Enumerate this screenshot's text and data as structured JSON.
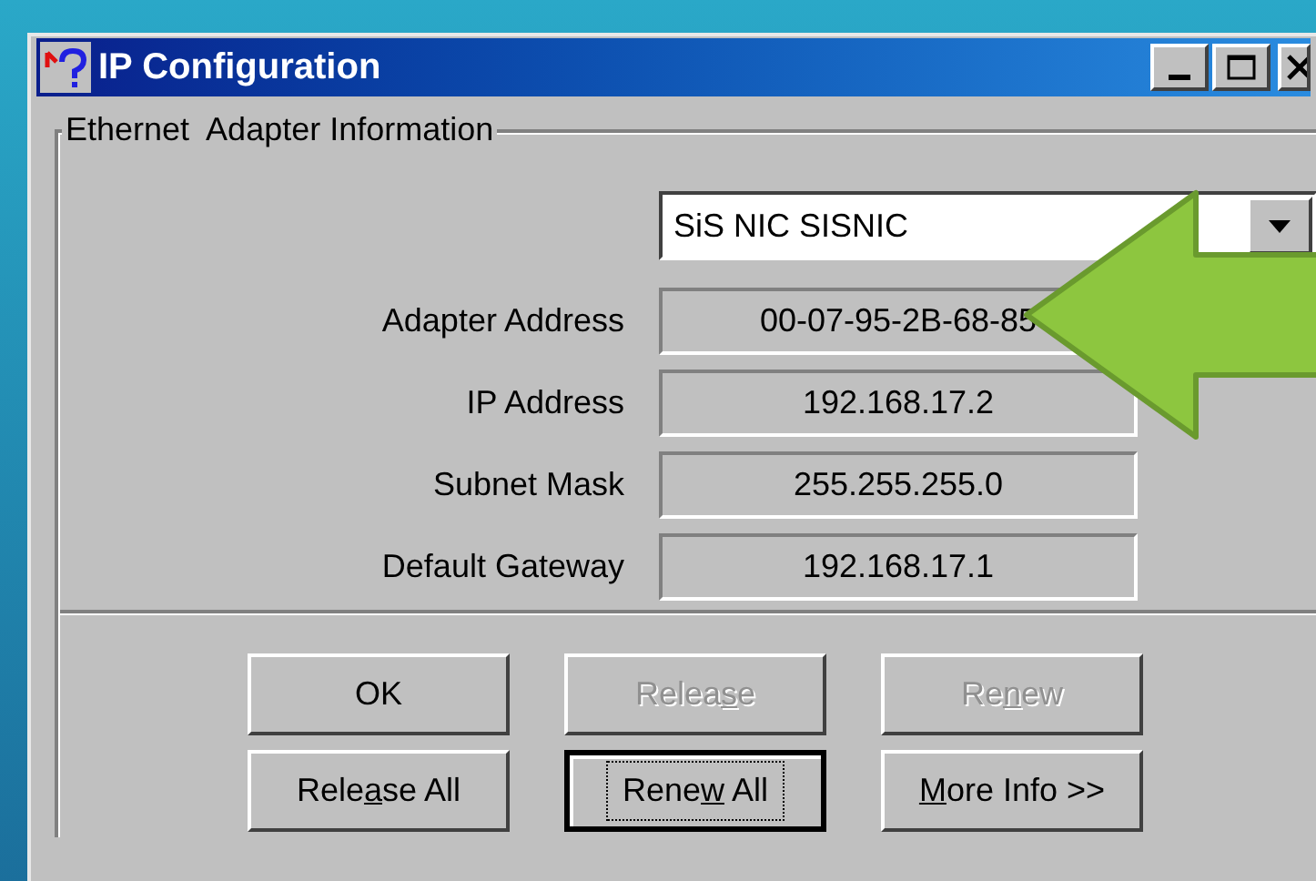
{
  "window": {
    "title": "IP Configuration"
  },
  "group": {
    "title": "Ethernet  Adapter Information"
  },
  "adapter_select": {
    "value": "SiS NIC SISNIC"
  },
  "fields": [
    {
      "label": "Adapter Address",
      "value": "00-07-95-2B-68-85"
    },
    {
      "label": "IP Address",
      "value": "192.168.17.2"
    },
    {
      "label": "Subnet Mask",
      "value": "255.255.255.0"
    },
    {
      "label": "Default Gateway",
      "value": "192.168.17.1"
    }
  ],
  "buttons": [
    {
      "label": [
        {
          "text": "OK",
          "underlined": false
        }
      ],
      "disabled": false,
      "focused": false
    },
    {
      "label": [
        {
          "text": "Relea",
          "underlined": false
        },
        {
          "text": "s",
          "underlined": true
        },
        {
          "text": "e",
          "underlined": false
        }
      ],
      "disabled": true,
      "focused": false
    },
    {
      "label": [
        {
          "text": "Re",
          "underlined": false
        },
        {
          "text": "n",
          "underlined": true
        },
        {
          "text": "ew",
          "underlined": false
        }
      ],
      "disabled": true,
      "focused": false
    },
    {
      "label": [
        {
          "text": "Rele",
          "underlined": false
        },
        {
          "text": "a",
          "underlined": true
        },
        {
          "text": "se All",
          "underlined": false
        }
      ],
      "disabled": false,
      "focused": false
    },
    {
      "label": [
        {
          "text": "Rene",
          "underlined": false
        },
        {
          "text": "w",
          "underlined": true
        },
        {
          "text": " All",
          "underlined": false
        }
      ],
      "disabled": false,
      "focused": true
    },
    {
      "label": [
        {
          "text": "M",
          "underlined": true
        },
        {
          "text": "ore Info >>",
          "underlined": false
        }
      ],
      "disabled": false,
      "focused": false
    }
  ]
}
